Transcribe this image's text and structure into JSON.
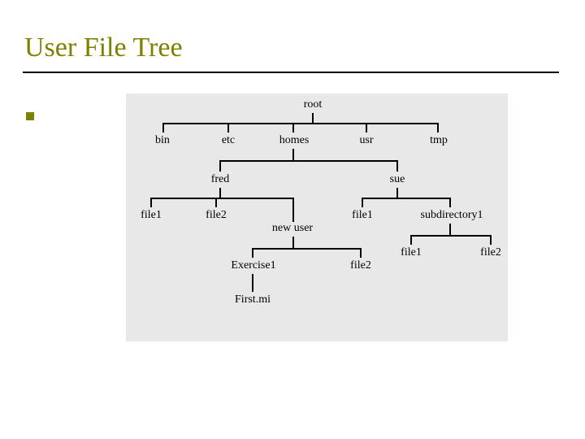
{
  "title": "User File Tree",
  "tree": {
    "root": "root",
    "level1": {
      "bin": "bin",
      "etc": "etc",
      "homes": "homes",
      "usr": "usr",
      "tmp": "tmp"
    },
    "level2": {
      "fred": "fred",
      "sue": "sue"
    },
    "fred_children": {
      "file1": "file1",
      "file2": "file2",
      "newuser": "new user"
    },
    "sue_children": {
      "file1": "file1",
      "subdirectory1": "subdirectory1"
    },
    "newuser_children": {
      "exercise1": "Exercise1",
      "file2": "file2"
    },
    "exercise1_children": {
      "firstmi": "First.mi"
    },
    "subdir_children": {
      "file1": "file1",
      "file2": "file2"
    }
  }
}
